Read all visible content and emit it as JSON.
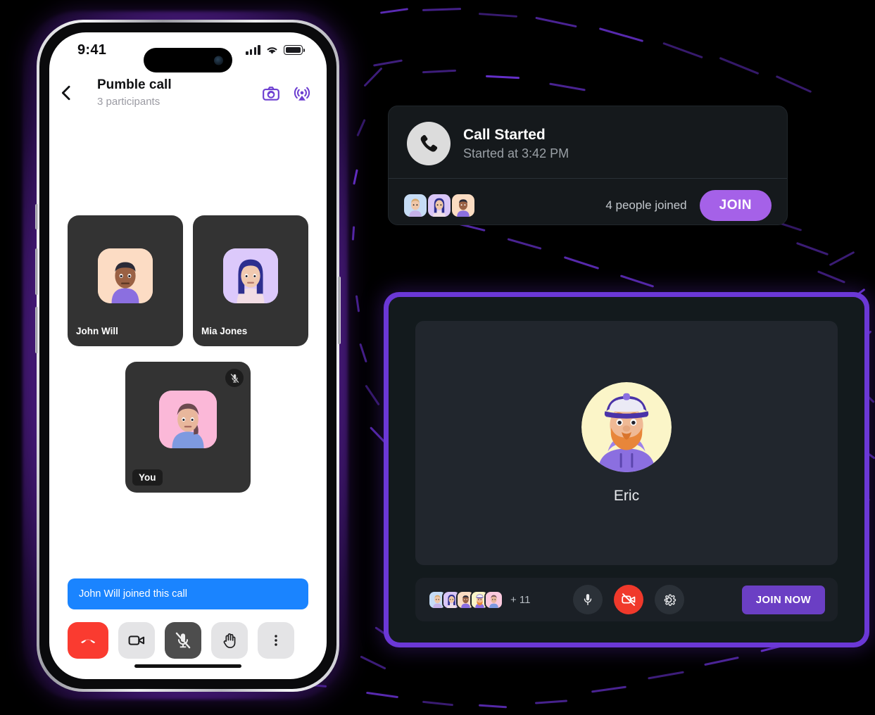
{
  "phone": {
    "status": {
      "time": "9:41",
      "signal_icon": "cellular-signal-icon",
      "wifi_icon": "wifi-icon",
      "battery_icon": "battery-icon"
    },
    "header": {
      "back_icon": "back-chevron-icon",
      "title": "Pumble call",
      "subtitle": "3 participants",
      "camera_flip_icon": "camera-flip-icon",
      "cast_icon": "airplay-cast-icon"
    },
    "participants": [
      {
        "name": "John Will",
        "muted": false,
        "avatar": "avatar-john-will",
        "bg": "#fcdcc4"
      },
      {
        "name": "Mia Jones",
        "muted": false,
        "avatar": "avatar-mia-jones",
        "bg": "#dcc9fb"
      },
      {
        "name": "You",
        "muted": true,
        "avatar": "avatar-you",
        "bg": "#fbb8d8"
      }
    ],
    "banner": {
      "text": "John Will joined this call",
      "color": "#1a84ff"
    },
    "toolbar": [
      {
        "name": "end-call-button",
        "icon": "phone-hangup-icon",
        "style": "end"
      },
      {
        "name": "camera-button",
        "icon": "video-camera-icon",
        "style": "light"
      },
      {
        "name": "mic-button",
        "icon": "microphone-muted-icon",
        "style": "muted"
      },
      {
        "name": "raise-hand-button",
        "icon": "raised-hand-icon",
        "style": "light"
      },
      {
        "name": "more-options-button",
        "icon": "more-vertical-icon",
        "style": "light"
      }
    ]
  },
  "call_card": {
    "icon": "phone-call-icon",
    "title": "Call Started",
    "subtitle": "Started at 3:42 PM",
    "avatars": [
      "avatar-blond",
      "avatar-blue-hair",
      "avatar-dark-hair"
    ],
    "joined_text": "4 people joined",
    "join_label": "JOIN",
    "join_color": "#a561e8"
  },
  "desktop": {
    "border_color": "#6b38d6",
    "preview": {
      "name": "Eric",
      "avatar": "avatar-eric"
    },
    "bar": {
      "avatars": [
        "avatar-1",
        "avatar-2",
        "avatar-3",
        "avatar-4",
        "avatar-5"
      ],
      "overflow_count": "+ 11",
      "controls": [
        {
          "name": "mic-toggle-button",
          "icon": "microphone-icon",
          "state": "on"
        },
        {
          "name": "camera-toggle-button",
          "icon": "video-camera-off-icon",
          "state": "off"
        },
        {
          "name": "settings-button",
          "icon": "gear-icon",
          "state": "default"
        }
      ],
      "join_now_label": "JOIN NOW",
      "join_now_color": "#6b3fc4"
    }
  }
}
